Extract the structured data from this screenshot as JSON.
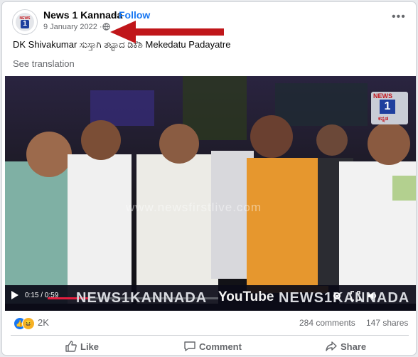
{
  "post": {
    "page_name": "News 1 Kannada",
    "separator": "·",
    "follow_label": "Follow",
    "date": "9 January 2022 ·",
    "text": "DK Shivakumar  ಸುಸ್ತಾಗಿ ತಟ್ಟಾದ ಡಿಕೆಶಿ  Mekedatu Padayatre",
    "see_translation": "See translation",
    "more_icon": "•••"
  },
  "avatar": {
    "logo_top": "NEWS",
    "logo_one": "1"
  },
  "video": {
    "time": "0:15 / 0:59",
    "progress_fraction": 0.25,
    "brand_left": "NEWS1KANNADA",
    "youtube": "YouTube",
    "brand_right": "NEWS1KANNADA",
    "watermark": "www.newsfirstlive.com",
    "logo_news": "NEWS",
    "logo_one": "1",
    "logo_kannada": "ಕನ್ನಡ"
  },
  "engagement": {
    "reaction_count": "2K",
    "comments": "284 comments",
    "shares": "147 shares"
  },
  "actions": {
    "like": "Like",
    "comment": "Comment",
    "share": "Share"
  },
  "colors": {
    "accent": "#1877f2",
    "arrow": "#c0161a",
    "secondary_text": "#65676b"
  }
}
